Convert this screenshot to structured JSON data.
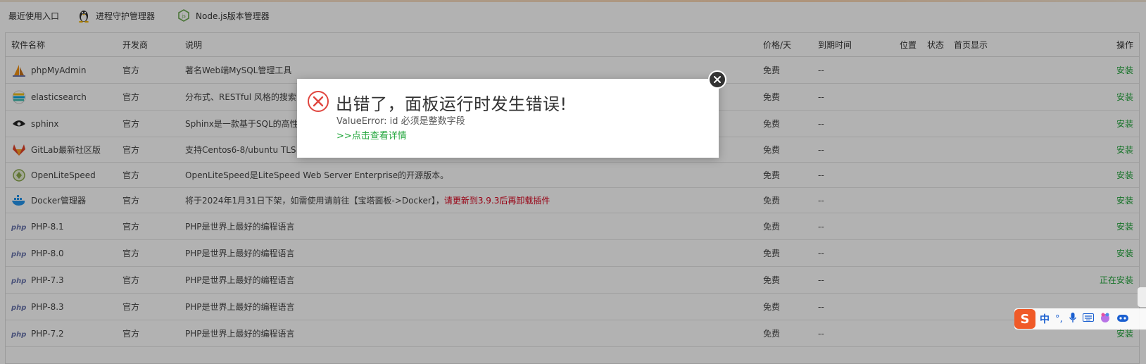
{
  "recent": {
    "label": "最近使用入口",
    "items": [
      {
        "name": "进程守护管理器",
        "icon": "linux-tux-icon"
      },
      {
        "name": "Node.js版本管理器",
        "icon": "nodejs-icon"
      }
    ]
  },
  "table": {
    "headers": {
      "name": "软件名称",
      "dev": "开发商",
      "desc": "说明",
      "price": "价格/天",
      "expire": "到期时间",
      "position": "位置",
      "status": "状态",
      "home": "首页显示",
      "op": "操作"
    },
    "rows": [
      {
        "name": "phpMyAdmin",
        "dev": "官方",
        "desc": "著名Web端MySQL管理工具",
        "price": "免费",
        "expire": "--",
        "op": "安装",
        "logo": "phpmyadmin-icon"
      },
      {
        "name": "elasticsearch",
        "dev": "官方",
        "desc": "分布式、RESTful 风格的搜索",
        "price": "免费",
        "expire": "--",
        "op": "安装",
        "logo": "elasticsearch-icon"
      },
      {
        "name": "sphinx",
        "dev": "官方",
        "desc": "Sphinx是一款基于SQL的高性",
        "price": "免费",
        "expire": "--",
        "op": "安装",
        "logo": "sphinx-eye-icon"
      },
      {
        "name": "GitLab最新社区版",
        "dev": "官方",
        "desc": "支持Centos6-8/ubuntu TLS",
        "price": "免费",
        "expire": "--",
        "op": "安装",
        "logo": "gitlab-icon"
      },
      {
        "name": "OpenLiteSpeed",
        "dev": "官方",
        "desc": "OpenLiteSpeed是LiteSpeed Web Server Enterprise的开源版本。",
        "price": "免费",
        "expire": "--",
        "op": "安装",
        "logo": "openlitespeed-icon"
      },
      {
        "name": "Docker管理器",
        "dev": "官方",
        "desc": "将于2024年1月31日下架，如需使用请前往【宝塔面板->Docker】，",
        "desc_warn": "请更新到3.9.3后再卸载插件",
        "price": "免费",
        "expire": "--",
        "op": "安装",
        "logo": "docker-whale-icon"
      },
      {
        "name": "PHP-8.1",
        "dev": "官方",
        "desc": "PHP是世界上最好的编程语言",
        "price": "免费",
        "expire": "--",
        "op": "安装",
        "logo": "php-icon"
      },
      {
        "name": "PHP-8.0",
        "dev": "官方",
        "desc": "PHP是世界上最好的编程语言",
        "price": "免费",
        "expire": "--",
        "op": "安装",
        "logo": "php-icon"
      },
      {
        "name": "PHP-7.3",
        "dev": "官方",
        "desc": "PHP是世界上最好的编程语言",
        "price": "免费",
        "expire": "--",
        "op": "正在安装",
        "logo": "php-icon"
      },
      {
        "name": "PHP-8.3",
        "dev": "官方",
        "desc": "PHP是世界上最好的编程语言",
        "price": "免费",
        "expire": "--",
        "op": "",
        "logo": "php-icon"
      },
      {
        "name": "PHP-7.2",
        "dev": "官方",
        "desc": "PHP是世界上最好的编程语言",
        "price": "免费",
        "expire": "--",
        "op": "安装",
        "logo": "php-icon"
      }
    ]
  },
  "modal": {
    "title": "出错了，面板运行时发生错误!",
    "detail": "ValueError: id 必须是整数字段",
    "link": ">>点击查看详情"
  },
  "ime": {
    "logo": "S",
    "lang": "中",
    "punct": "°,"
  },
  "colors": {
    "accent": "#20a53a",
    "warning": "#d9001b",
    "error": "#e0463f",
    "overlay": "rgba(0,0,0,0.30)"
  }
}
